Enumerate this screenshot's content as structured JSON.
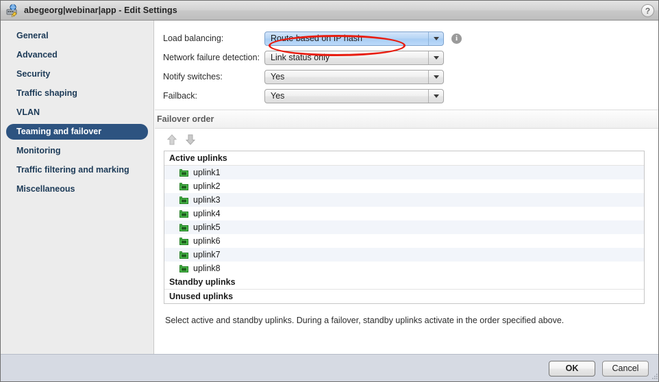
{
  "window": {
    "title": "abegeorg|webinar|app - Edit Settings",
    "icon": "network-switch-edit-icon",
    "help_label": "?"
  },
  "sidebar": {
    "items": [
      {
        "label": "General",
        "selected": false
      },
      {
        "label": "Advanced",
        "selected": false
      },
      {
        "label": "Security",
        "selected": false
      },
      {
        "label": "Traffic shaping",
        "selected": false
      },
      {
        "label": "VLAN",
        "selected": false
      },
      {
        "label": "Teaming and failover",
        "selected": true
      },
      {
        "label": "Monitoring",
        "selected": false
      },
      {
        "label": "Traffic filtering and marking",
        "selected": false
      },
      {
        "label": "Miscellaneous",
        "selected": false
      }
    ]
  },
  "form": {
    "rows": [
      {
        "label": "Load balancing:",
        "value": "Route based on IP hash",
        "focused": true,
        "has_info": true
      },
      {
        "label": "Network failure detection:",
        "value": "Link status only",
        "focused": false,
        "has_info": false
      },
      {
        "label": "Notify switches:",
        "value": "Yes",
        "focused": false,
        "has_info": false
      },
      {
        "label": "Failback:",
        "value": "Yes",
        "focused": false,
        "has_info": false
      }
    ]
  },
  "annotation": {
    "shape": "ellipse",
    "color": "#e81d10",
    "target": "Load balancing dropdown"
  },
  "failover": {
    "section_title": "Failover order",
    "move_up_label": "Move up",
    "move_down_label": "Move down",
    "groups": [
      {
        "header": "Active uplinks",
        "items": [
          {
            "label": "uplink1",
            "icon": "nic-icon"
          },
          {
            "label": "uplink2",
            "icon": "nic-icon"
          },
          {
            "label": "uplink3",
            "icon": "nic-icon"
          },
          {
            "label": "uplink4",
            "icon": "nic-icon"
          },
          {
            "label": "uplink5",
            "icon": "nic-icon"
          },
          {
            "label": "uplink6",
            "icon": "nic-icon"
          },
          {
            "label": "uplink7",
            "icon": "nic-icon"
          },
          {
            "label": "uplink8",
            "icon": "nic-icon"
          }
        ]
      },
      {
        "header": "Standby uplinks",
        "items": []
      },
      {
        "header": "Unused uplinks",
        "items": []
      }
    ],
    "hint": "Select active and standby uplinks. During a failover, standby uplinks activate in the order specified above."
  },
  "buttons": {
    "ok": "OK",
    "cancel": "Cancel"
  },
  "colors": {
    "selection": "#2d5380",
    "annotation": "#e81d10",
    "focus_field": "#b7d5f5",
    "bottom_bar": "#d6dae3",
    "sidebar": "#ececec"
  }
}
